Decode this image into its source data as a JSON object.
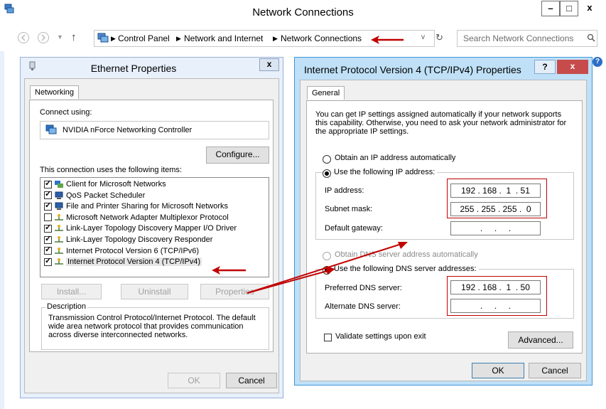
{
  "main_window": {
    "title": "Network Connections",
    "controls": {
      "minimize": "–",
      "maximize": "□",
      "close": "x"
    },
    "breadcrumb": [
      "Control Panel",
      "Network and Internet",
      "Network Connections"
    ],
    "search_placeholder": "Search Network Connections"
  },
  "ethernet": {
    "title": "Ethernet Properties",
    "close": "x",
    "tab": "Networking",
    "connect_using_label": "Connect using:",
    "adapter": "NVIDIA nForce Networking Controller",
    "configure_button": "Configure...",
    "items_label": "This connection uses the following items:",
    "items": [
      {
        "label": "Client for Microsoft Networks",
        "checked": true,
        "icon": "network-client-icon"
      },
      {
        "label": "QoS Packet Scheduler",
        "checked": true,
        "icon": "computer-icon"
      },
      {
        "label": "File and Printer Sharing for Microsoft Networks",
        "checked": true,
        "icon": "computer-icon"
      },
      {
        "label": "Microsoft Network Adapter Multiplexor Protocol",
        "checked": false,
        "icon": "protocol-icon"
      },
      {
        "label": "Link-Layer Topology Discovery Mapper I/O Driver",
        "checked": true,
        "icon": "protocol-icon"
      },
      {
        "label": "Link-Layer Topology Discovery Responder",
        "checked": true,
        "icon": "protocol-icon"
      },
      {
        "label": "Internet Protocol Version 6 (TCP/IPv6)",
        "checked": true,
        "icon": "protocol-icon"
      },
      {
        "label": "Internet Protocol Version 4 (TCP/IPv4)",
        "checked": true,
        "icon": "protocol-icon"
      }
    ],
    "install_button": "Install...",
    "uninstall_button": "Uninstall",
    "properties_button": "Properties",
    "description_label": "Description",
    "description_text": "Transmission Control Protocol/Internet Protocol. The default wide area network protocol that provides communication across diverse interconnected networks.",
    "ok_button": "OK",
    "cancel_button": "Cancel"
  },
  "ipv4": {
    "title": "Internet Protocol Version 4 (TCP/IPv4) Properties",
    "help": "?",
    "close": "x",
    "tab": "General",
    "intro": "You can get IP settings assigned automatically if your network supports this capability. Otherwise, you need to ask your network administrator for the appropriate IP settings.",
    "obtain_ip_auto": "Obtain an IP address automatically",
    "use_following_ip": "Use the following IP address:",
    "ip_address_label": "IP address:",
    "ip_address_value": "192 . 168 .  1  . 51",
    "subnet_label": "Subnet mask:",
    "subnet_value": "255 . 255 . 255 .  0",
    "gateway_label": "Default gateway:",
    "gateway_value": " .     .     . ",
    "obtain_dns_auto": "Obtain DNS server address automatically",
    "use_following_dns": "Use the following DNS server addresses:",
    "preferred_dns_label": "Preferred DNS server:",
    "preferred_dns_value": "192 . 168 .  1  . 50",
    "alternate_dns_label": "Alternate DNS server:",
    "alternate_dns_value": " .     .     . ",
    "validate_label": "Validate settings upon exit",
    "advanced_button": "Advanced...",
    "ok_button": "OK",
    "cancel_button": "Cancel"
  },
  "colors": {
    "annotation_red": "#c00000",
    "dialog_frame": "#e8f0fb",
    "ipv4_titlebar": "#bfe0f7",
    "close_red": "#c74b4b"
  }
}
